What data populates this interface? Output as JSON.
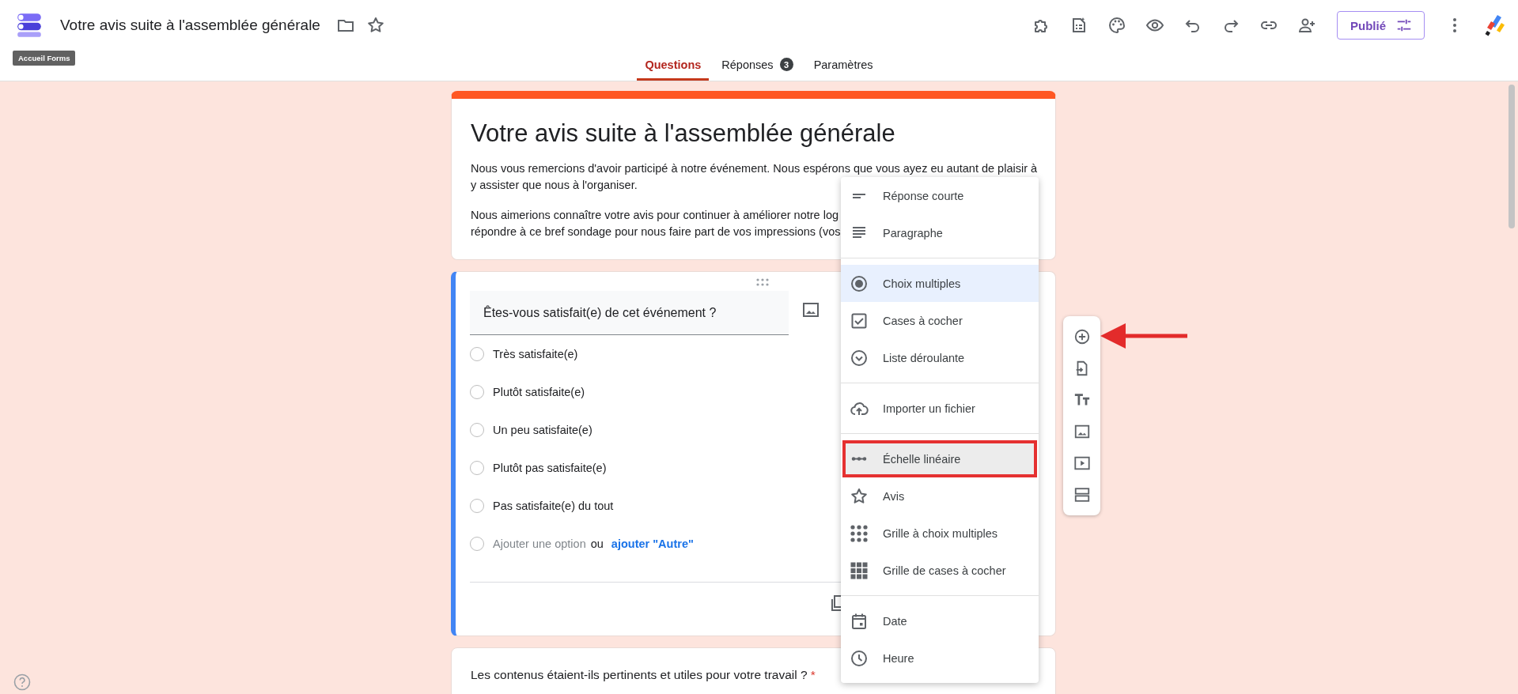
{
  "header": {
    "title": "Votre avis suite à l'assemblée générale",
    "tooltip": "Accueil Forms",
    "publish_button": "Publié"
  },
  "tabs": [
    {
      "label": "Questions",
      "selected": true
    },
    {
      "label": "Réponses",
      "selected": false,
      "badge": "3"
    },
    {
      "label": "Paramètres",
      "selected": false
    }
  ],
  "form": {
    "title": "Votre avis suite à l'assemblée générale",
    "description": [
      [
        "Nous vous remercions d'avoir participé à notre événement. Nous espérons que vous ayez eu autant de plaisir à",
        "y assister que nous à l'organiser."
      ],
      [
        "Nous aimerions connaître votre avis pour continuer à améliorer notre log",
        "répondre à ce bref sondage pour nous faire part de vos impressions (vos"
      ]
    ]
  },
  "question": {
    "title": "Êtes-vous satisfait(e) de cet événement ?",
    "options": [
      {
        "label": "Très satisfaite(e)",
        "selected": false
      },
      {
        "label": "Plutôt satisfaite(e)",
        "selected": false
      },
      {
        "label": "Un peu satisfaite(e)",
        "selected": false
      },
      {
        "label": "Plutôt pas satisfaite(e)",
        "selected": false
      },
      {
        "label": "Pas satisfaite(e) du tout",
        "selected": false
      }
    ],
    "add_option": {
      "selected": false,
      "placeholder": "Ajouter une option",
      "separator": "ou",
      "link": "ajouter \"Autre\""
    }
  },
  "next_question": {
    "title": "Les contenus étaient-ils pertinents et utiles pour votre travail ?",
    "required": true,
    "required_mark": "*"
  },
  "type_menu": {
    "groups": [
      [
        {
          "label": "Réponse courte",
          "selected": false,
          "hovered": false,
          "outlined": false
        },
        {
          "label": "Paragraphe",
          "selected": false,
          "hovered": false,
          "outlined": false
        }
      ],
      [
        {
          "label": "Choix multiples",
          "selected": true,
          "hovered": false,
          "outlined": false
        },
        {
          "label": "Cases à cocher",
          "selected": false,
          "hovered": false,
          "outlined": false
        },
        {
          "label": "Liste déroulante",
          "selected": false,
          "hovered": false,
          "outlined": false
        }
      ],
      [
        {
          "label": "Importer un fichier",
          "selected": false,
          "hovered": false,
          "outlined": false
        }
      ],
      [
        {
          "label": "Échelle linéaire",
          "selected": false,
          "hovered": true,
          "outlined": true
        },
        {
          "label": "Avis",
          "selected": false,
          "hovered": false,
          "outlined": false
        },
        {
          "label": "Grille à choix multiples",
          "selected": false,
          "hovered": false,
          "outlined": false
        },
        {
          "label": "Grille de cases à cocher",
          "selected": false,
          "hovered": false,
          "outlined": false
        }
      ],
      [
        {
          "label": "Date",
          "selected": false,
          "hovered": false,
          "outlined": false
        },
        {
          "label": "Heure",
          "selected": false,
          "hovered": false,
          "outlined": false
        }
      ]
    ]
  }
}
